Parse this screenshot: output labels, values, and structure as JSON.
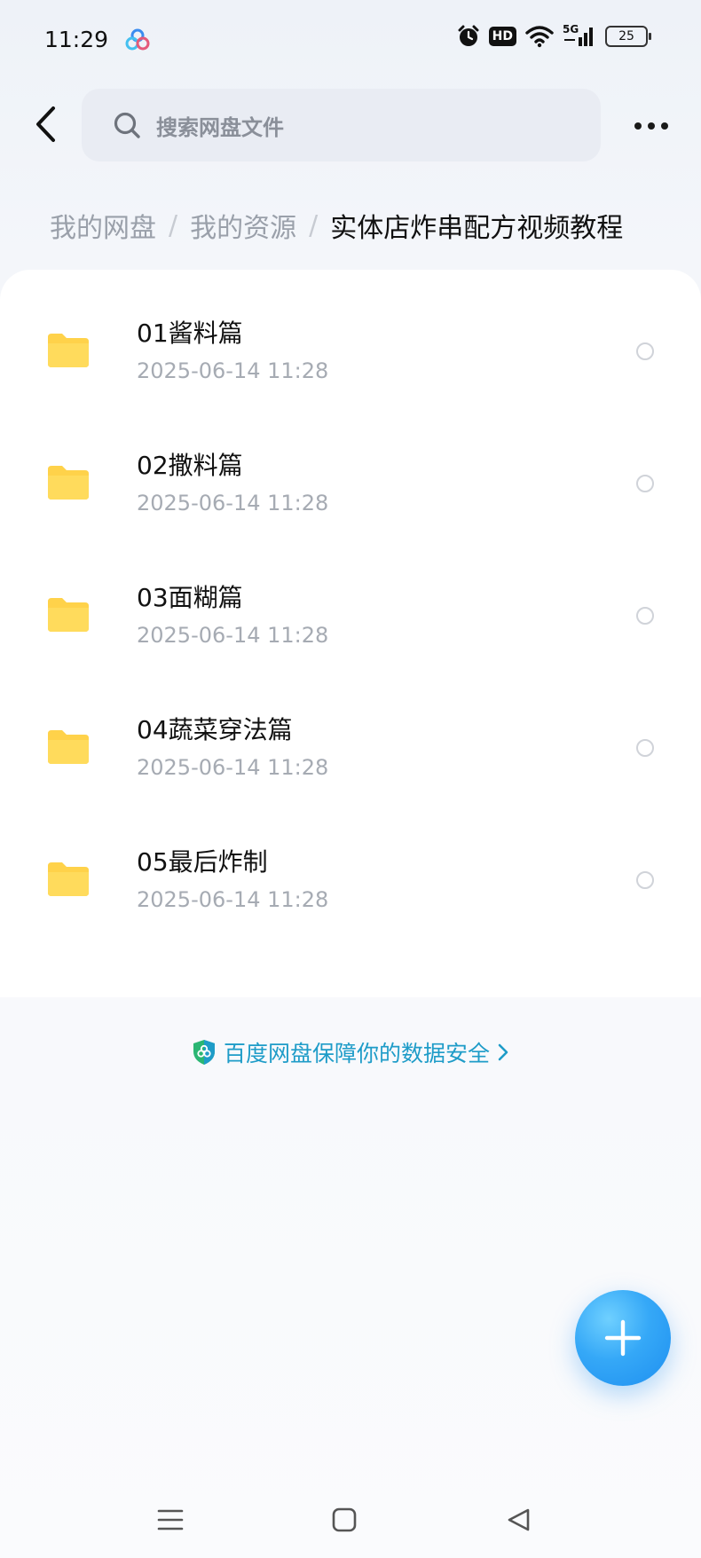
{
  "status_bar": {
    "time": "11:29",
    "network": "5G",
    "hd_label": "HD",
    "battery": "25"
  },
  "search": {
    "placeholder": "搜索网盘文件"
  },
  "breadcrumb": {
    "items": [
      "我的网盘",
      "我的资源"
    ],
    "current": "实体店炸串配方视频教程",
    "separator": "/"
  },
  "files": [
    {
      "name": "01酱料篇",
      "date": "2025-06-14  11:28",
      "type": "folder"
    },
    {
      "name": "02撒料篇",
      "date": "2025-06-14  11:28",
      "type": "folder"
    },
    {
      "name": "03面糊篇",
      "date": "2025-06-14  11:28",
      "type": "folder"
    },
    {
      "name": "04蔬菜穿法篇",
      "date": "2025-06-14  11:28",
      "type": "folder"
    },
    {
      "name": "05最后炸制",
      "date": "2025-06-14  11:28",
      "type": "folder"
    }
  ],
  "security_banner": {
    "text": "百度网盘保障你的数据安全"
  },
  "colors": {
    "folder": "#ffd24a",
    "accent_blue": "#1e9cc8",
    "fab": "#35a8f7"
  },
  "icons": {
    "back": "chevron-left-icon",
    "search": "search-icon",
    "more": "more-dots-icon",
    "folder": "folder-icon",
    "add": "plus-icon"
  }
}
